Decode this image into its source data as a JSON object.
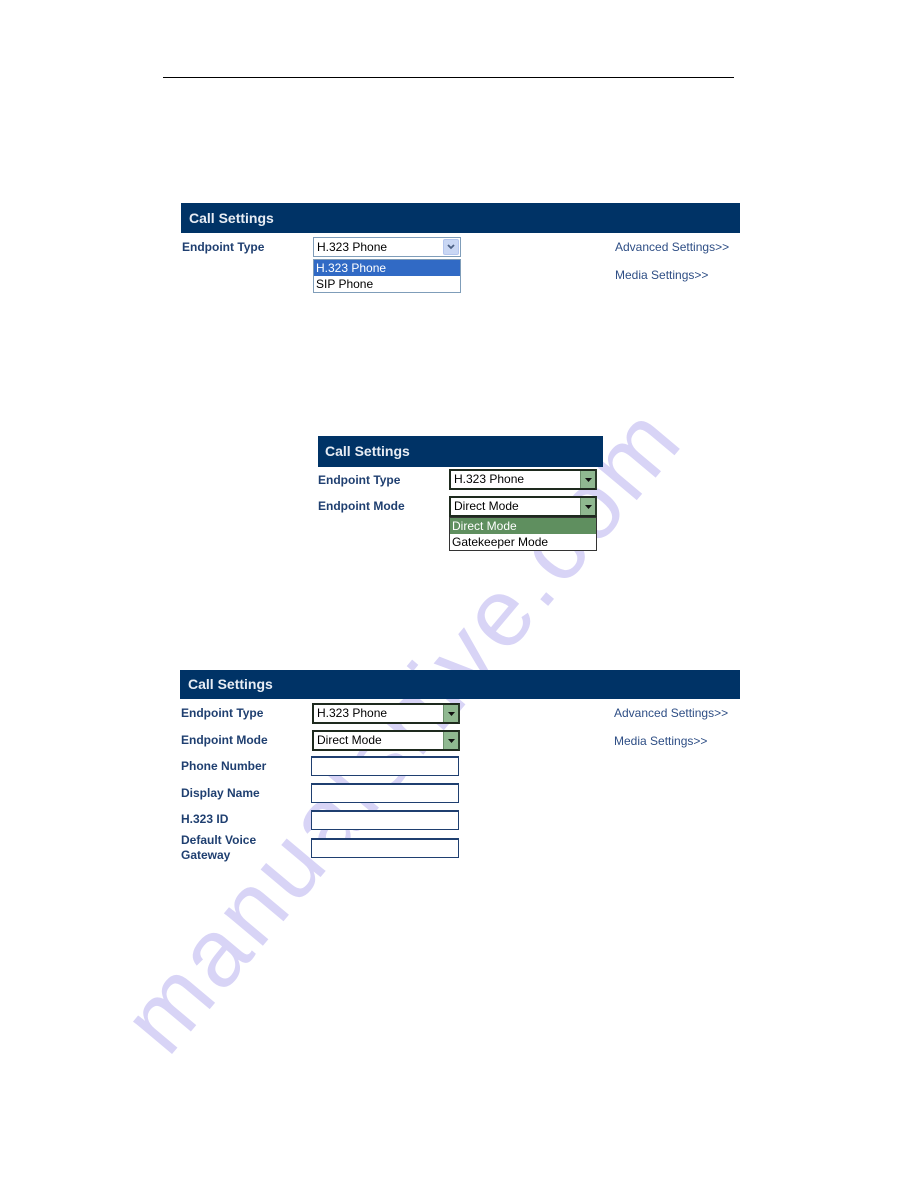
{
  "document": {
    "screens": [
      {
        "id": "endpoint-type-open",
        "header": "Call Settings",
        "fields": [
          {
            "label": "Endpoint Type",
            "type": "select",
            "value": "H.323 Phone",
            "open": true,
            "options": [
              "H.323 Phone",
              "SIP Phone"
            ],
            "highlighted": "H.323 Phone"
          }
        ],
        "links": [
          "Advanced Settings>>",
          "Media Settings>>"
        ]
      },
      {
        "id": "endpoint-mode-open",
        "header": "Call Settings",
        "fields": [
          {
            "label": "Endpoint Type",
            "type": "select",
            "value": "H.323 Phone"
          },
          {
            "label": "Endpoint Mode",
            "type": "select",
            "value": "Direct Mode",
            "open": true,
            "options": [
              "Direct Mode",
              "Gatekeeper Mode"
            ],
            "highlighted": "Direct Mode"
          }
        ]
      },
      {
        "id": "direct-mode-form",
        "header": "Call Settings",
        "fields": [
          {
            "label": "Endpoint Type",
            "type": "select",
            "value": "H.323 Phone"
          },
          {
            "label": "Endpoint Mode",
            "type": "select",
            "value": "Direct Mode"
          },
          {
            "label": "Phone Number",
            "type": "text",
            "value": ""
          },
          {
            "label": "Display Name",
            "type": "text",
            "value": ""
          },
          {
            "label": "H.323 ID",
            "type": "text",
            "value": ""
          },
          {
            "label": "Default Voice Gateway",
            "type": "text",
            "value": ""
          }
        ],
        "links": [
          "Advanced Settings>>",
          "Media Settings>>"
        ]
      }
    ]
  },
  "colors": {
    "header_bg": "#003366",
    "label_text": "#1f3f70",
    "link_text": "#2e4e85",
    "xp_highlight": "#316ac5",
    "green_highlight": "#5f8f5f",
    "watermark": "#d8d4f6"
  },
  "icons": {
    "select_arrow": "chevron-down-icon",
    "select_arrow_classic": "triangle-down-icon"
  }
}
